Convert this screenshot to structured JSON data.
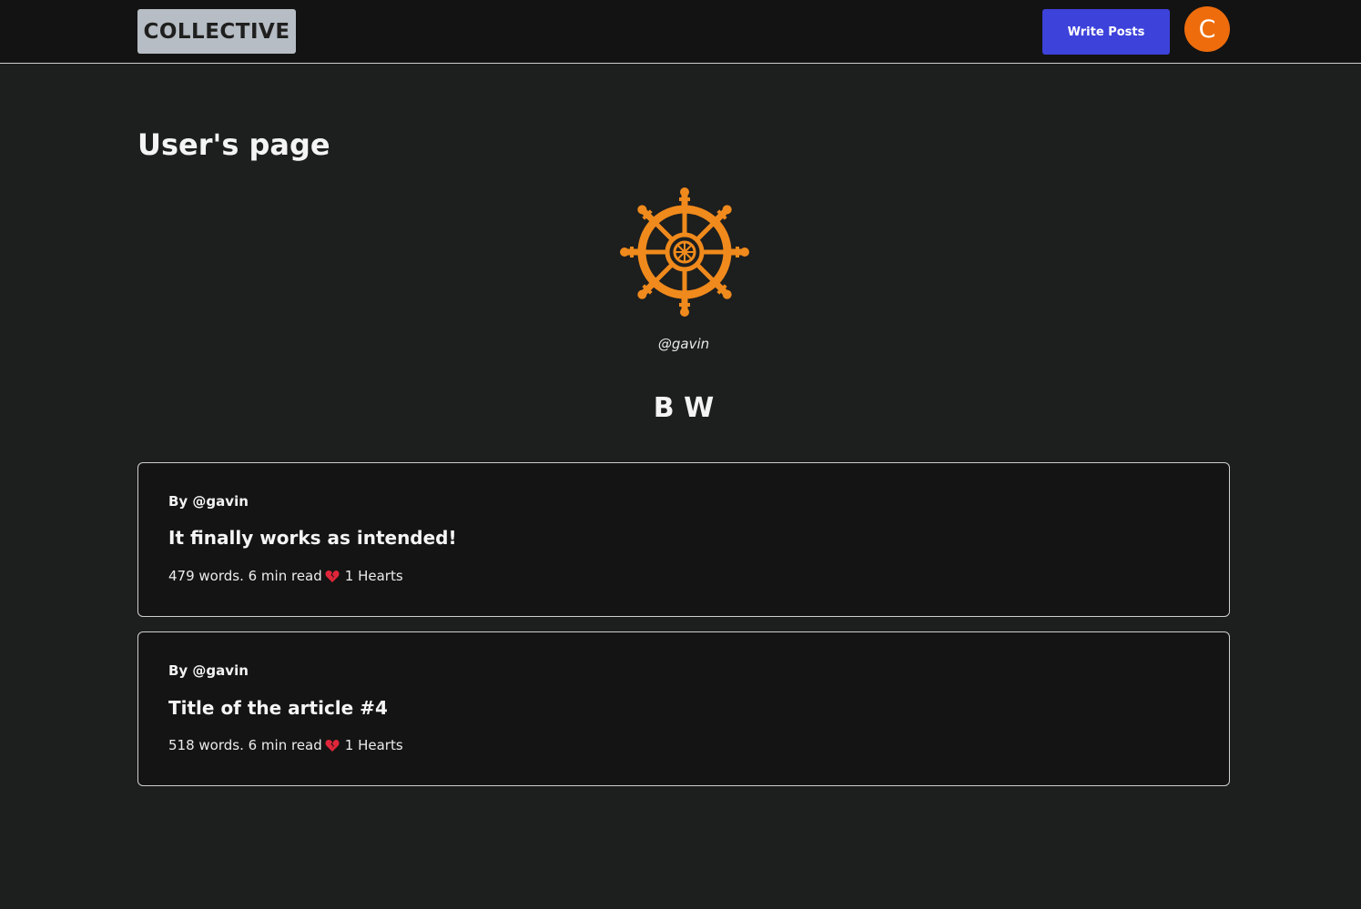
{
  "header": {
    "logo": "COLLECTIVE",
    "write_button": "Write Posts",
    "avatar_letter": "C"
  },
  "page": {
    "title": "User's page",
    "handle": "@gavin",
    "display_name": "B W",
    "profile_icon": "dharma-wheel-icon"
  },
  "posts": [
    {
      "author": "By @gavin",
      "title": "It finally works as intended!",
      "meta": "479 words. 6 min read",
      "hearts": "1 Hearts"
    },
    {
      "author": "By @gavin",
      "title": "Title of the article #4",
      "meta": "518 words. 6 min read",
      "hearts": "1 Hearts"
    }
  ],
  "colors": {
    "accent": "#3d42db",
    "avatar": "#ee6c0c",
    "wheel": "#f08a1c"
  }
}
